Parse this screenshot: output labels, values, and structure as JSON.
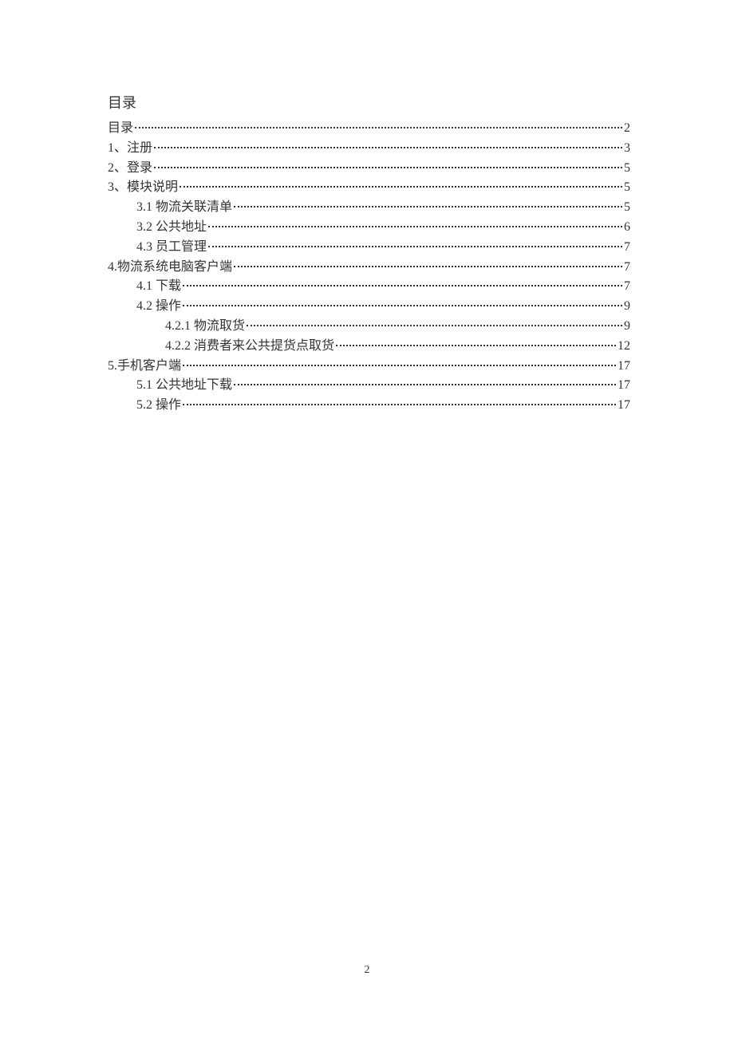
{
  "title": "目录",
  "pageNumber": "2",
  "entries": [
    {
      "label": "目录",
      "page": "2",
      "indent": 0
    },
    {
      "label": "1、注册",
      "page": "3",
      "indent": 0
    },
    {
      "label": "2、登录",
      "page": "5",
      "indent": 0
    },
    {
      "label": "3、模块说明",
      "page": "5",
      "indent": 0
    },
    {
      "label": "3.1 物流关联清单",
      "page": "5",
      "indent": 1
    },
    {
      "label": "3.2 公共地址",
      "page": "6",
      "indent": 1
    },
    {
      "label": "4.3 员工管理",
      "page": "7",
      "indent": 1
    },
    {
      "label": "4.物流系统电脑客户端",
      "page": "7",
      "indent": 0
    },
    {
      "label": "4.1 下载",
      "page": "7",
      "indent": 1
    },
    {
      "label": "4.2 操作",
      "page": "9",
      "indent": 1
    },
    {
      "label": "4.2.1 物流取货",
      "page": "9",
      "indent": 2
    },
    {
      "label": "4.2.2 消费者来公共提货点取货",
      "page": "12",
      "indent": 2
    },
    {
      "label": "5.手机客户端",
      "page": "17",
      "indent": 0
    },
    {
      "label": "5.1 公共地址下载",
      "page": "17",
      "indent": 1
    },
    {
      "label": "5.2 操作",
      "page": "17",
      "indent": 1
    }
  ]
}
